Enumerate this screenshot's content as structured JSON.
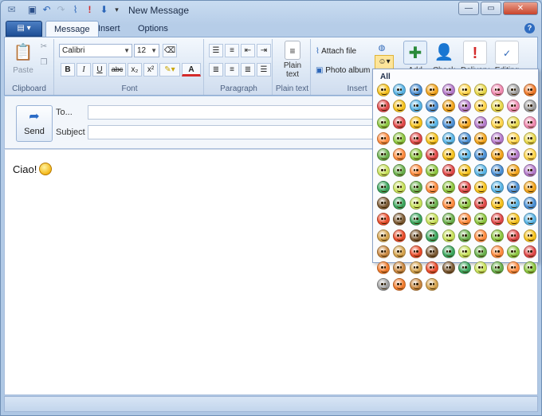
{
  "window": {
    "title": "New Message"
  },
  "tabs": [
    {
      "label": "Message",
      "active": true
    },
    {
      "label": "Insert",
      "active": false
    },
    {
      "label": "Options",
      "active": false
    }
  ],
  "ribbon": {
    "clipboard": {
      "group_label": "Clipboard",
      "paste_label": "Paste"
    },
    "font": {
      "group_label": "Font",
      "font_name": "Calibri",
      "font_size": "12",
      "bold": "B",
      "italic": "I",
      "underline": "U",
      "strike": "abc",
      "subscript": "x₂",
      "superscript": "x²",
      "font_color_glyph": "A"
    },
    "paragraph": {
      "group_label": "Paragraph"
    },
    "plain_text": {
      "group_label": "Plain text",
      "button_label_line1": "Plain",
      "button_label_line2": "text"
    },
    "insert": {
      "group_label": "Insert",
      "attach_file": "Attach file",
      "photo_album": "Photo album"
    },
    "add_label": "Add",
    "check_label": "Check",
    "delivery_label": "Delivery",
    "editing_label": "Editing"
  },
  "header": {
    "send_label": "Send",
    "to_label": "To...",
    "subject_label": "Subject",
    "to_value": "",
    "subject_value": ""
  },
  "body": {
    "text": "Ciao!"
  },
  "emoticon_panel": {
    "title": "All",
    "count": 124,
    "colors": [
      "#f6c21c",
      "#f2a41b",
      "#e8d84a",
      "#f07a2a",
      "#e94b2a",
      "#c7e15a",
      "#8cc63f",
      "#58b4e6",
      "#b57acb",
      "#f08ab0",
      "#c9873f",
      "#7c5a34",
      "#6ab04c",
      "#e04848",
      "#4a8fd4",
      "#ffd54a",
      "#9e9e9e",
      "#d4a24c",
      "#3aa55c",
      "#ff8a3d"
    ]
  },
  "colors": {
    "accent": "#2f6cc0",
    "ribbon_border": "#8ba9d0"
  }
}
